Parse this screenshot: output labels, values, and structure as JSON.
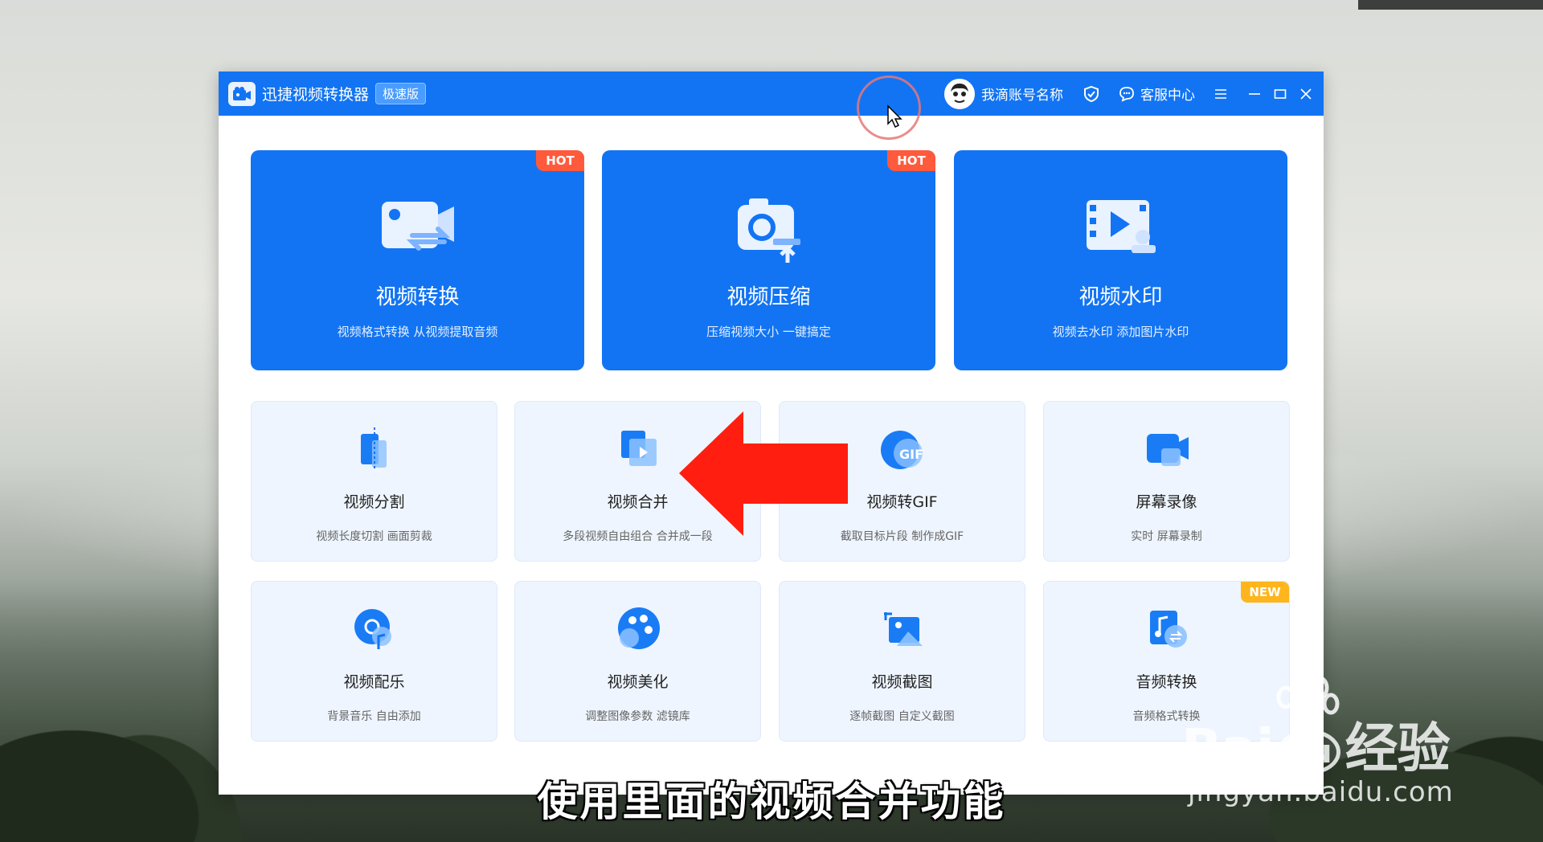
{
  "window": {
    "app_title": "迅捷视频转换器",
    "edition_badge": "极速版",
    "account_name": "我滴账号名称",
    "service_label": "客服中心"
  },
  "feature_cards": [
    {
      "title": "视频转换",
      "subtitle": "视频格式转换 从视频提取音频",
      "badge": "HOT",
      "icon": "video-convert-icon"
    },
    {
      "title": "视频压缩",
      "subtitle": "压缩视频大小 一键搞定",
      "badge": "HOT",
      "icon": "video-compress-icon"
    },
    {
      "title": "视频水印",
      "subtitle": "视频去水印 添加图片水印",
      "badge": "",
      "icon": "video-watermark-icon"
    }
  ],
  "tool_cards": [
    {
      "title": "视频分割",
      "subtitle": "视频长度切割 画面剪裁",
      "icon": "video-split-icon"
    },
    {
      "title": "视频合并",
      "subtitle": "多段视频自由组合 合并成一段",
      "icon": "video-merge-icon"
    },
    {
      "title": "视频转GIF",
      "subtitle": "截取目标片段 制作成GIF",
      "icon": "gif-icon"
    },
    {
      "title": "屏幕录像",
      "subtitle": "实时 屏幕录制",
      "icon": "screen-record-icon"
    },
    {
      "title": "视频配乐",
      "subtitle": "背景音乐 自由添加",
      "icon": "music-icon"
    },
    {
      "title": "视频美化",
      "subtitle": "调整图像参数 滤镜库",
      "icon": "palette-icon"
    },
    {
      "title": "视频截图",
      "subtitle": "逐帧截图 自定义截图",
      "icon": "screenshot-icon"
    },
    {
      "title": "音频转换",
      "subtitle": "音频格式转换",
      "badge": "NEW",
      "icon": "audio-convert-icon"
    }
  ],
  "colors": {
    "brand_blue": "#1274f3",
    "hot_badge": "#ff5a3c",
    "new_badge": "#ffb51c",
    "arrow_red": "#ff1e10"
  },
  "overlay": {
    "caption": "使用里面的视频合并功能",
    "watermark_brand": "Bai",
    "watermark_brand2": "经验",
    "watermark_site": "jingyan.baidu.com"
  }
}
